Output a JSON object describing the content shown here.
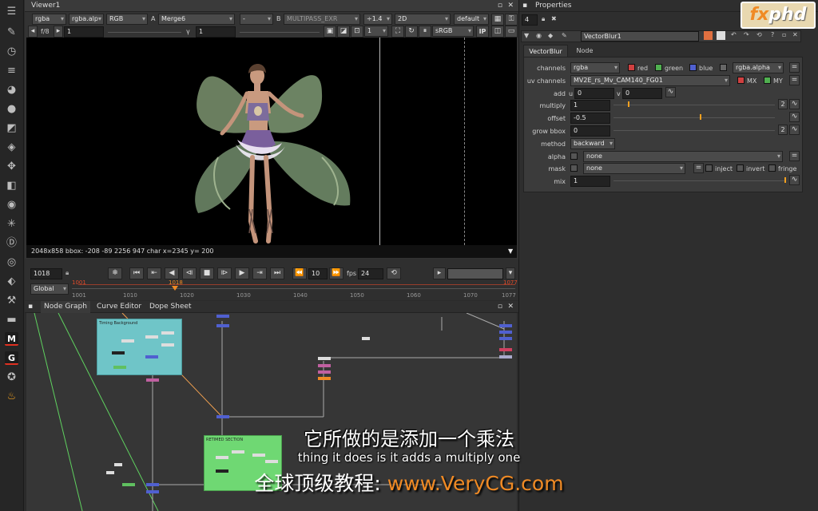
{
  "toolbar": {
    "icons": [
      "layout-icon",
      "paint-icon",
      "clock-icon",
      "channel-icon",
      "color-icon",
      "sphere-icon",
      "filter-icon",
      "layers-icon",
      "transform-icon",
      "cube-icon",
      "eye-icon",
      "particles-icon",
      "deep-icon",
      "views-icon",
      "keyer-icon",
      "tools-icon",
      "menu-icon",
      "metadata-icon",
      "gizmo-icon",
      "other-icon",
      "furnace-icon"
    ],
    "m_label": "M",
    "g_label": "G"
  },
  "viewer": {
    "tab": "Viewer1",
    "row1": {
      "channels": "rgba",
      "alpha": "rgba.alp",
      "display": "RGB",
      "a_label": "A",
      "a_input": "Merge6",
      "op": "-",
      "b_label": "B",
      "b_input": "MULTIPASS_EXR",
      "zoom": "÷1.4",
      "view_mode": "2D",
      "lut": "default"
    },
    "row2": {
      "fstop": "f/8",
      "gain": "1",
      "gamma_label": "γ",
      "gamma": "1",
      "proxy": "1",
      "colorspace": "sRGB",
      "ip": "IP"
    },
    "status": "2048x858 bbox: -208 -89 2256 947 char  x=2345 y= 200"
  },
  "timeline": {
    "frame": "1018",
    "step": "10",
    "fps_label": "fps",
    "fps": "24",
    "scope": "Global",
    "in_marker": "1001",
    "current_marker": "1018",
    "out_marker": "1077",
    "start": "1001",
    "ticks": [
      "1010",
      "1020",
      "1030",
      "1040",
      "1050",
      "1060",
      "1070",
      "1077"
    ]
  },
  "graph": {
    "tabs": [
      "Node Graph",
      "Curve Editor",
      "Dope Sheet"
    ],
    "backdrop1": "Timing Background",
    "backdrop2": "RETIMED SECTION"
  },
  "properties": {
    "title": "Properties",
    "max_panels": "4",
    "node_name": "VectorBlur1",
    "tabs": [
      "VectorBlur",
      "Node"
    ],
    "channels_label": "channels",
    "channels": "rgba",
    "red": "red",
    "green": "green",
    "blue": "blue",
    "alpha_ch": "rgba.alpha",
    "uv_label": "uv channels",
    "uv": "MV2E_rs_Mv_CAM140_FG01",
    "mx": "MX",
    "my": "MY",
    "add_label": "add",
    "u_label": "u",
    "add_u": "0",
    "v_label": "v",
    "add_v": "0",
    "multiply_label": "multiply",
    "multiply": "1",
    "offset_label": "offset",
    "offset": "-0.5",
    "grow_label": "grow bbox",
    "grow": "0",
    "method_label": "method",
    "method": "backward",
    "alpha_label": "alpha",
    "alpha": "none",
    "mask_label": "mask",
    "mask": "none",
    "inject": "inject",
    "invert": "invert",
    "fringe": "fringe",
    "mix_label": "mix",
    "mix": "1",
    "count_2": "2"
  },
  "logo": {
    "fx": "fx",
    "phd": "phd"
  },
  "subtitles": {
    "chinese": "它所做的是添加一个乘法",
    "english": "thing it does is it adds a multiply one",
    "watermark_cn": "全球顶级教程: ",
    "watermark_url": "www.VeryCG.com"
  },
  "colors": {
    "backdrop_teal": "#6fc5c8",
    "backdrop_green": "#6fd873",
    "accent_orange": "#f08a24",
    "timeline_red": "#e04a2a"
  }
}
